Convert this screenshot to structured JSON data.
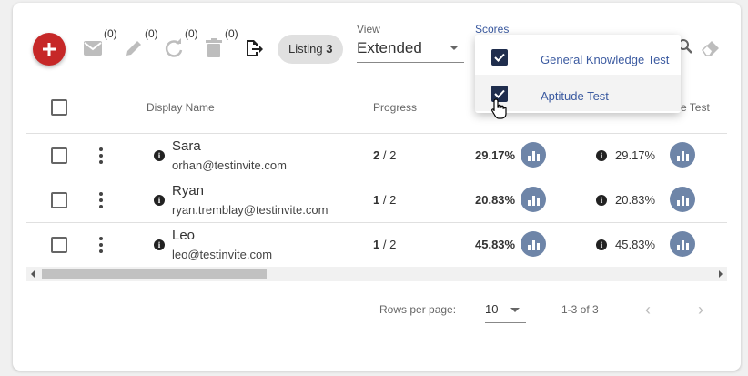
{
  "toolbar": {
    "mail_count": "(0)",
    "edit_count": "(0)",
    "refresh_count": "(0)",
    "delete_count": "(0)",
    "chip_label": "Listing",
    "chip_count": "3"
  },
  "view": {
    "label": "View",
    "value": "Extended"
  },
  "scores": {
    "label": "Scores",
    "options": [
      {
        "label": "General Knowledge Test",
        "checked": true
      },
      {
        "label": "Aptitude Test",
        "checked": true
      }
    ]
  },
  "table": {
    "headers": {
      "display_name": "Display Name",
      "progress": "Progress",
      "partial_col": "e Test"
    },
    "rows": [
      {
        "name": "Sara",
        "email": "orhan@testinvite.com",
        "progress_done": "2",
        "progress_total": "/ 2",
        "score1": "29.17%",
        "score2": "29.17%"
      },
      {
        "name": "Ryan",
        "email": "ryan.tremblay@testinvite.com",
        "progress_done": "1",
        "progress_total": "/ 2",
        "score1": "20.83%",
        "score2": "20.83%"
      },
      {
        "name": "Leo",
        "email": "leo@testinvite.com",
        "progress_done": "1",
        "progress_total": "/ 2",
        "score1": "45.83%",
        "score2": "45.83%"
      }
    ]
  },
  "pagination": {
    "rows_per_page_label": "Rows per page:",
    "rows_per_page_value": "10",
    "range": "1-3 of 3",
    "prev": "‹",
    "next": "›"
  },
  "colors": {
    "fab": "#c62828",
    "chart_button": "#6e85a8",
    "accent": "#3b5aa0"
  }
}
